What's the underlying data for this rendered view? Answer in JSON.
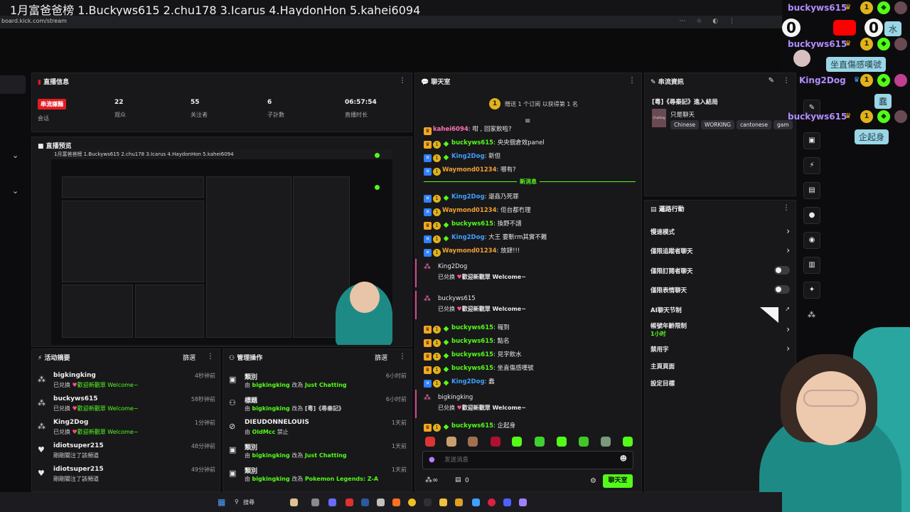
{
  "banner": {
    "text": "1月富爸爸榜 1.Buckyws615 2.chu178 3.Icarus 4.HaydonHon 5.kahei6094"
  },
  "browser": {
    "url": "board.kick.com/stream"
  },
  "stream_info": {
    "title": "直播信息",
    "live_badge": "串流嫌麵",
    "stats": [
      {
        "value": "",
        "label": "会话"
      },
      {
        "value": "22",
        "label": "观众"
      },
      {
        "value": "55",
        "label": "关注者"
      },
      {
        "value": "6",
        "label": "子計數"
      },
      {
        "value": "06:57:54",
        "label": "直播时长"
      }
    ]
  },
  "preview": {
    "title": "直播预览",
    "banner": "1月富爸爸榜 1.Buckyws615 2.chu178 3.Icarus 4.HaydonHon 5.kahei6094"
  },
  "activity": {
    "title": "活动摘要",
    "filter_label": "篩選",
    "items": [
      {
        "name": "bigkingking",
        "time": "4秒钟前",
        "action": "已兑换",
        "reward": "歡迎新觀眾 Welcome~"
      },
      {
        "name": "buckyws615",
        "time": "58秒钟前",
        "action": "已兑换",
        "reward": "歡迎新觀眾 Welcome~"
      },
      {
        "name": "King2Dog",
        "time": "1分钟前",
        "action": "已兑换",
        "reward": "歡迎新觀眾 Welcome~"
      },
      {
        "name": "idiotsuper215",
        "time": "48分钟前",
        "action": "剛剛關注了該頻道",
        "reward": ""
      },
      {
        "name": "idiotsuper215",
        "time": "49分钟前",
        "action": "剛剛關注了該頻道",
        "reward": ""
      }
    ]
  },
  "moderation": {
    "title": "管理操作",
    "filter_label": "篩選",
    "items": [
      {
        "label": "類別",
        "time": "6小时前",
        "by": "由",
        "user": "bigkingking",
        "mid": "改為",
        "value": "Just Chatting",
        "icon": "category-icon"
      },
      {
        "label": "標題",
        "time": "6小时前",
        "by": "由",
        "user": "bigkingking",
        "mid": "改為",
        "value": "[粵]《尋秦記》",
        "icon": "title-icon"
      },
      {
        "label": "DIEUDONNELOUIS",
        "time": "1天前",
        "by": "由",
        "user": "OldMcc",
        "mid": "禁止",
        "value": "",
        "icon": "ban-icon"
      },
      {
        "label": "類別",
        "time": "1天前",
        "by": "由",
        "user": "bigkingking",
        "mid": "改為",
        "value": "Just Chatting",
        "icon": "category-icon"
      },
      {
        "label": "類別",
        "time": "1天前",
        "by": "由",
        "user": "bigkingking",
        "mid": "改為",
        "value": "Pokemon Legends: Z-A",
        "icon": "category-icon"
      }
    ]
  },
  "chat": {
    "title": "聊天室",
    "gift_text": "贈送 1 个订阅 以获得第 1 名",
    "gift_rank": "1",
    "new_messages": "新消息",
    "input_placeholder": "发送消息",
    "send_label": "聊天室",
    "footer_count": "0",
    "messages": [
      {
        "user": "kahei6094",
        "text": "咁 , 回家飲啦?",
        "color": "pink"
      },
      {
        "user": "buckyws615",
        "text": "央央個倉效panel",
        "color": "green"
      },
      {
        "user": "King2Dog",
        "text": "新但",
        "color": "blue"
      },
      {
        "user": "Waymond01234",
        "text": "哪有?",
        "color": "orange"
      },
      {
        "user": "King2Dog",
        "text": "還姦乃死罪",
        "color": "blue"
      },
      {
        "user": "Waymond01234",
        "text": "佢台都冇理",
        "color": "orange"
      },
      {
        "user": "buckyws615",
        "text": "換野不譜",
        "color": "green"
      },
      {
        "user": "King2Dog",
        "text": "大王 要斬rm其實不難",
        "color": "blue"
      },
      {
        "user": "Waymond01234",
        "text": "放肆!!!",
        "color": "orange"
      },
      {
        "user": "buckyws615",
        "text": "報到",
        "color": "green"
      },
      {
        "user": "buckyws615",
        "text": "點名",
        "color": "green"
      },
      {
        "user": "buckyws615",
        "text": "見字飲水",
        "color": "green"
      },
      {
        "user": "buckyws615",
        "text": "坐直傷感嘆號",
        "color": "green"
      },
      {
        "user": "King2Dog",
        "text": "蠢",
        "color": "blue"
      },
      {
        "user": "buckyws615",
        "text": "企起身",
        "color": "green"
      }
    ],
    "redeems": [
      {
        "user": "King2Dog",
        "action": "已兑换",
        "reward": "歡迎新觀眾 Welcome~"
      },
      {
        "user": "buckyws615",
        "action": "已兑换",
        "reward": "歡迎新觀眾 Welcome~"
      },
      {
        "user": "bigkingking",
        "action": "已兑换",
        "reward": "歡迎新觀眾 Welcome~"
      }
    ]
  },
  "stream_details": {
    "title": "串流資訊",
    "stream_title": "[粵]《尋秦記》進入結局",
    "category": "只是聊天",
    "category_thumb": "Chatting",
    "tags": [
      "Chinese",
      "WORKING",
      "cantonese",
      "gam"
    ]
  },
  "quick_actions": {
    "title": "邏路行動",
    "items": [
      {
        "label": "慢速模式",
        "control": "arrow",
        "sub": ""
      },
      {
        "label": "僅限追蹤者聊天",
        "control": "arrow",
        "sub": ""
      },
      {
        "label": "僅限訂閱者聊天",
        "control": "toggle",
        "sub": ""
      },
      {
        "label": "僅限表情聊天",
        "control": "toggle",
        "sub": ""
      },
      {
        "label": "AI聊天节制",
        "control": "external",
        "sub": ""
      },
      {
        "label": "帳號年齡限制",
        "control": "arrow",
        "sub": "1小时"
      },
      {
        "label": "禁用字",
        "control": "arrow",
        "sub": ""
      },
      {
        "label": "主頁頁面",
        "control": "none",
        "sub": ""
      },
      {
        "label": "設定目標",
        "control": "arrow",
        "sub": ""
      }
    ]
  },
  "overlay": {
    "lines": [
      {
        "name": "buckyws615",
        "message": "見字飲水",
        "message_short": "水"
      },
      {
        "name": "buckyws615",
        "message": "坐直傷感嘆號"
      },
      {
        "name": "King2Dog",
        "message": "蠢"
      },
      {
        "name": "buckyws615",
        "message": "企起身"
      }
    ],
    "counter_left": "0",
    "counter_right": "0"
  },
  "taskbar": {
    "search_label": "搜尋"
  },
  "colors": {
    "kick_green": "#53fc18",
    "panel": "#18181b",
    "live_red": "#e31b23",
    "bubble": "#9ad6e6"
  }
}
